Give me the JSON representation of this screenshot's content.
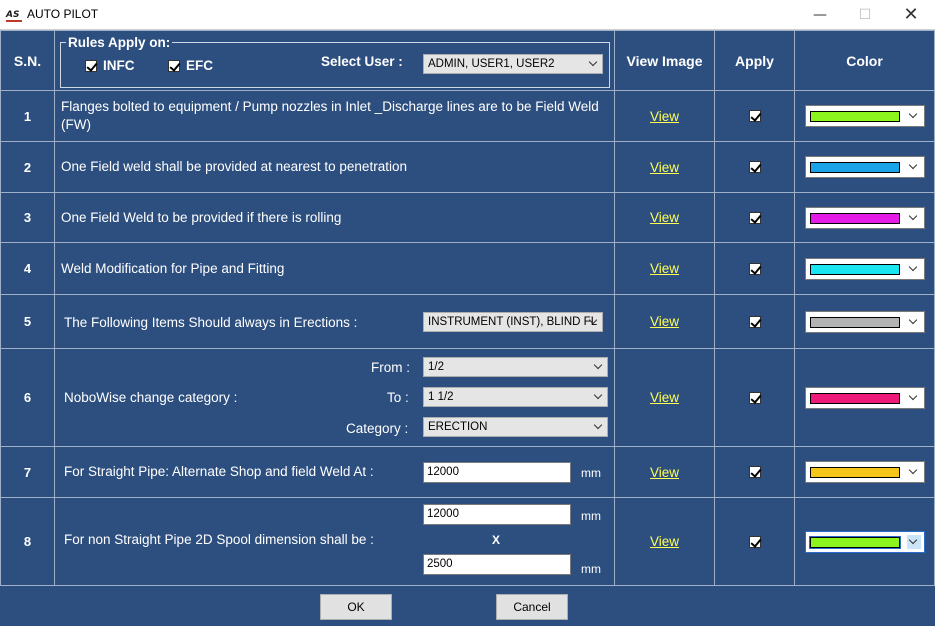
{
  "window": {
    "title": "AUTO PILOT",
    "logo_text": "AS",
    "minimize_glyph": "—",
    "maximize_glyph": "☐",
    "close_glyph": "✕"
  },
  "header": {
    "sn": "S.N.",
    "rules_title": "Rules Apply on:",
    "infc_label": "INFC",
    "infc_checked": true,
    "efc_label": "EFC",
    "efc_checked": true,
    "select_user_label": "Select User :",
    "select_user_value": "ADMIN, USER1, USER2",
    "view_image": "View Image",
    "apply": "Apply",
    "color": "Color"
  },
  "rows": [
    {
      "sn": "1",
      "text": "Flanges bolted to equipment / Pump nozzles in Inlet _Discharge lines are to be Field Weld (FW)",
      "view": "View",
      "applied": true,
      "color": "#8cf51e"
    },
    {
      "sn": "2",
      "text": "One Field weld shall be provided at nearest to penetration",
      "view": "View",
      "applied": true,
      "color": "#1aa3e6"
    },
    {
      "sn": "3",
      "text": "One Field Weld to be provided if there is rolling",
      "view": "View",
      "applied": true,
      "color": "#e61ae6"
    },
    {
      "sn": "4",
      "text": "Weld Modification for Pipe and Fitting",
      "view": "View",
      "applied": true,
      "color": "#1ae6f2"
    },
    {
      "sn": "5",
      "text": "The Following Items Should always in Erections :",
      "dropdown": "INSTRUMENT (INST), BLIND FL",
      "view": "View",
      "applied": true,
      "color": "#b3b3b3"
    },
    {
      "sn": "6",
      "text": "NoboWise change category :",
      "from_label": "From :",
      "from_value": "1/2",
      "to_label": "To :",
      "to_value": "1 1/2",
      "category_label": "Category :",
      "category_value": "ERECTION",
      "view": "View",
      "applied": true,
      "color": "#ee1a7a"
    },
    {
      "sn": "7",
      "text": "For Straight Pipe: Alternate Shop and field Weld At :",
      "value": "12000",
      "unit": "mm",
      "view": "View",
      "applied": true,
      "color": "#f5c51a"
    },
    {
      "sn": "8",
      "text": "For non Straight Pipe 2D Spool dimension shall be :",
      "value1": "12000",
      "unit1": "mm",
      "separator": "X",
      "value2": "2500",
      "unit2": "mm",
      "view": "View",
      "applied": true,
      "color": "#8cf51e"
    }
  ],
  "footer": {
    "ok": "OK",
    "cancel": "Cancel"
  }
}
